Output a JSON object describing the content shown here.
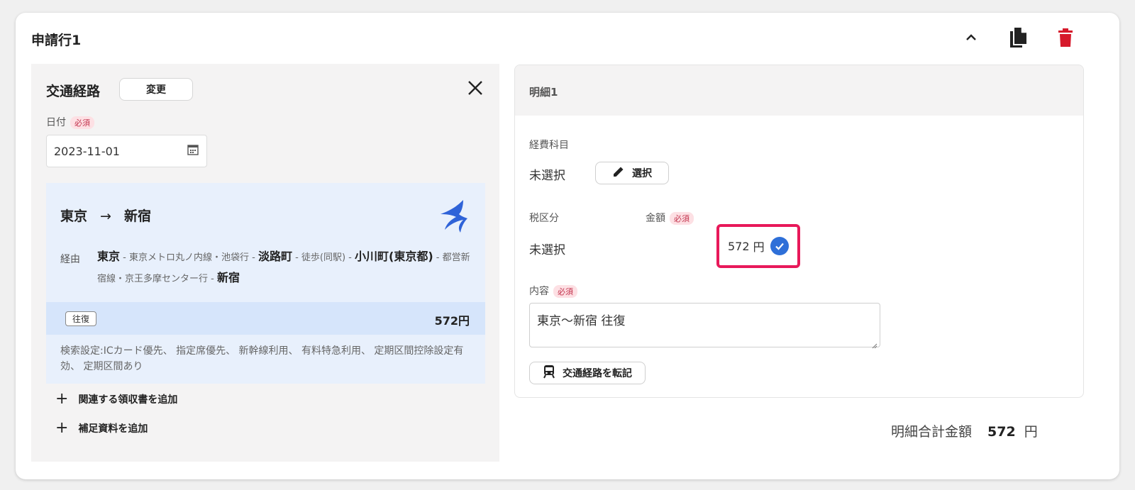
{
  "application": {
    "title": "申請行1",
    "actions": {
      "collapse_icon": "chevron-up-icon",
      "copy_icon": "copy-document-icon",
      "delete_icon": "trash-icon",
      "delete_color": "#d6192b"
    }
  },
  "route_panel": {
    "title": "交通経路",
    "change_label": "変更",
    "close_icon": "close-icon",
    "date": {
      "label": "日付",
      "required_badge": "必須",
      "value": "2023-11-01",
      "icon": "calendar-icon"
    },
    "route": {
      "from": "東京",
      "arrow": "→",
      "to": "新宿",
      "logo_icon": "swallow-logo-icon",
      "via_label": "経由",
      "via_segments": [
        {
          "text": "東京",
          "bold": true
        },
        {
          "text": " - 東京メトロ丸ノ内線・池袋行 - ",
          "bold": false
        },
        {
          "text": "淡路町",
          "bold": true
        },
        {
          "text": " - 徒歩(同駅) - ",
          "bold": false
        },
        {
          "text": "小川町(東京都)",
          "bold": true
        },
        {
          "text": " - 都営新宿線・京王多摩センター行 - ",
          "bold": false
        },
        {
          "text": "新宿",
          "bold": true
        }
      ],
      "trip_type": "往復",
      "fare": "572円",
      "search_settings": "検索設定:ICカード優先、 指定席優先、 新幹線利用、 有料特急利用、 定期区間控除設定有効、 定期区間あり"
    },
    "add_receipt_label": "関連する領収書を追加",
    "add_material_label": "補足資料を追加"
  },
  "detail_panel": {
    "title": "明細1",
    "expense_item_label": "経費科目",
    "expense_item_value": "未選択",
    "select_button_label": "選択",
    "tax_label": "税区分",
    "tax_value": "未選択",
    "amount_label": "金額",
    "amount_required": "必須",
    "amount_value": "572",
    "amount_unit": "円",
    "content_label": "内容",
    "content_required": "必須",
    "content_value": "東京～新宿 往復",
    "transfer_button_label": "交通経路を転記",
    "highlight_color": "#e8195a",
    "check_color": "#2e6fd8"
  },
  "summary": {
    "label": "明細合計金額",
    "value": "572",
    "unit": "円"
  }
}
